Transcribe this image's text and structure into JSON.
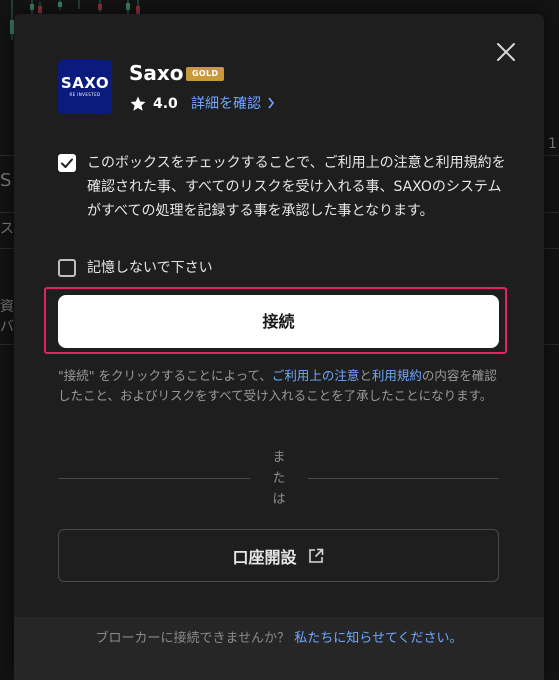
{
  "background": {
    "side_texts": [
      "S",
      "スク",
      "資料",
      "バ",
      "1"
    ]
  },
  "modal": {
    "close_icon": "close-icon",
    "logo": {
      "mark": "SAXO",
      "tagline": "RE INVESTED"
    },
    "broker_name": "Saxo",
    "badge": "GOLD",
    "rating": "4.0",
    "details_link": "詳細を確認",
    "consent": {
      "checked": true,
      "text": "このボックスをチェックすることで、ご利用上の注意と利用規約を確認された事、すべてのリスクを受け入れる事、SAXOのシステムがすべての処理を記録する事を承認した事となります。"
    },
    "remember": {
      "checked": false,
      "label": "記憶しないで下さい"
    },
    "connect_label": "接続",
    "terms_note": {
      "part1": "\"接続\" をクリックすることによって、",
      "link1": "ご利用上の注意",
      "part2": "と",
      "link2": "利用規約",
      "part3": "の内容を確認したこと、およびリスクをすべて受け入れることを了承したことになります。"
    },
    "or_text": [
      "ま",
      "た",
      "は"
    ],
    "open_account_label": "口座開設",
    "footer": {
      "question": "ブローカーに接続できませんか？",
      "link": "私たちに知らせてください。"
    }
  },
  "colors": {
    "accent_link": "#6fa8ff",
    "highlight": "#e0245e",
    "logo_bg": "#0b1b7d",
    "badge": "#c99a3a"
  }
}
